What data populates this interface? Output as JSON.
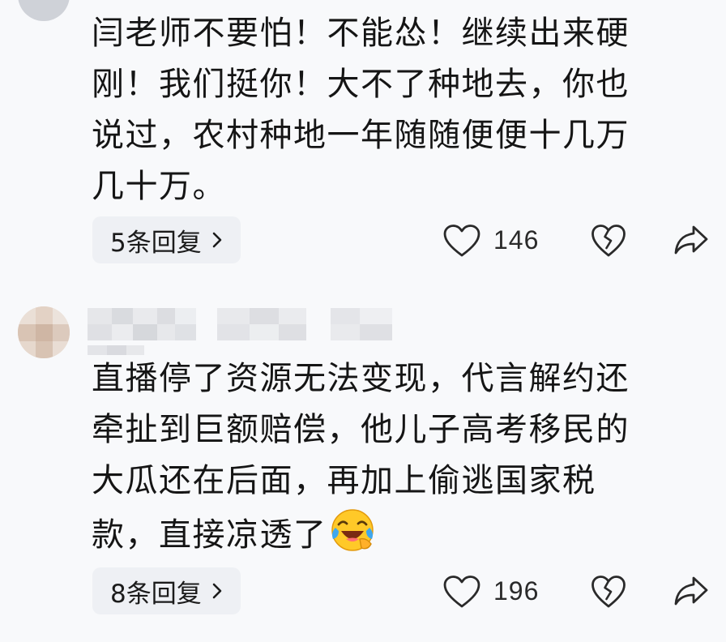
{
  "comments": [
    {
      "text_lines": [
        "闫老师不要怕！不能怂！继续出来硬",
        "刚！我们挺你！大不了种地去，你也",
        "说过，农村种地一年随随便便十几万",
        "几十万。"
      ],
      "replies_label": "5条回复",
      "like_count": "146"
    },
    {
      "text_lines": [
        "直播停了资源无法变现，代言解约还",
        "牵扯到巨额赔偿，他儿子高考移民的",
        "大瓜还在后面，再加上偷逃国家税",
        "款，直接凉透了"
      ],
      "emoji": "laughing-crying-emoji",
      "replies_label": "8条回复",
      "like_count": "196"
    }
  ],
  "icons": {
    "like": "heart-outline-icon",
    "dislike": "broken-heart-icon",
    "share": "share-arrow-icon",
    "replies_chevron": "chevron-right-icon"
  },
  "colors": {
    "background": "#f8f9fb",
    "reply_button_bg": "#eef0f4",
    "text": "#151515",
    "icon": "#2a2a2a"
  }
}
